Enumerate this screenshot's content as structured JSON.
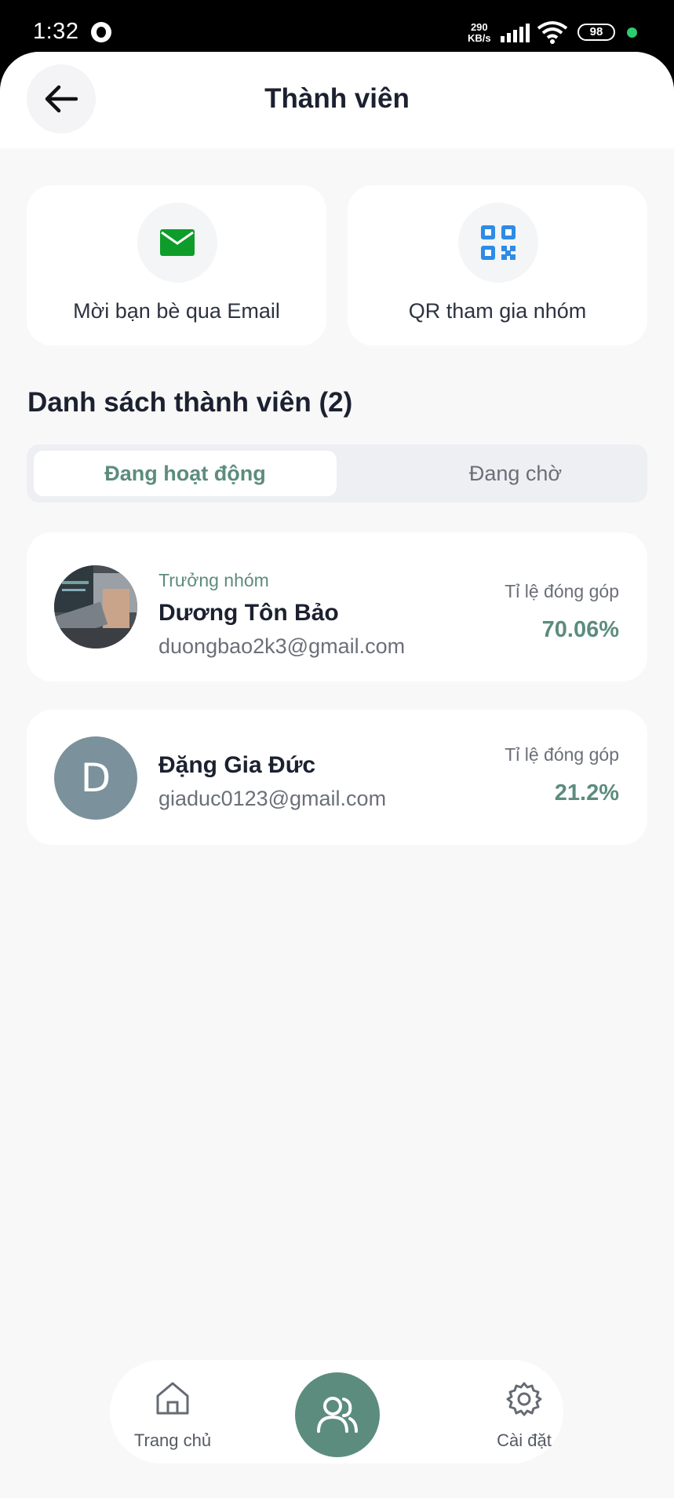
{
  "status_bar": {
    "time": "1:32",
    "speed_value": "290",
    "speed_unit": "KB/s",
    "battery": "98"
  },
  "header": {
    "title": "Thành viên",
    "back_icon": "arrow-left-icon"
  },
  "actions": [
    {
      "label": "Mời bạn bè qua Email",
      "icon": "mail-icon",
      "icon_color": "#0e9d2a"
    },
    {
      "label": "QR tham gia nhóm",
      "icon": "qr-code-icon",
      "icon_color": "#2e8be6"
    }
  ],
  "members_section": {
    "title": "Danh sách thành viên (2)",
    "tabs": [
      {
        "label": "Đang hoạt động",
        "active": true
      },
      {
        "label": "Đang chờ",
        "active": false
      }
    ]
  },
  "members": [
    {
      "role": "Trưởng nhóm",
      "name": "Dương Tôn Bảo",
      "email": "duongbao2k3@gmail.com",
      "contribution_label": "Tỉ lệ đóng góp",
      "contribution": "70.06%"
    },
    {
      "initial": "D",
      "name": "Đặng Gia Đức",
      "email": "giaduc0123@gmail.com",
      "contribution_label": "Tỉ lệ đóng góp",
      "contribution": "21.2%"
    }
  ],
  "bottom_nav": {
    "home_label": "Trang chủ",
    "settings_label": "Cài đặt"
  },
  "colors": {
    "accent": "#5c8c7e",
    "background": "#f8f8f9",
    "avatar_fallback": "#7b919c"
  }
}
